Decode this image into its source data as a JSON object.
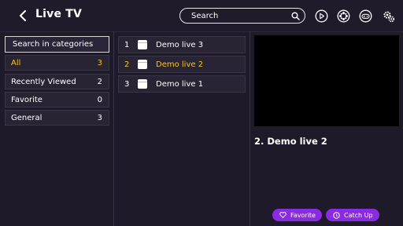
{
  "header": {
    "title": "Live TV",
    "search_placeholder": "Search",
    "icons": [
      "back-icon",
      "search-icon",
      "play-circle-icon",
      "film-reel-icon",
      "gamepad-icon",
      "settings-gear-icon"
    ]
  },
  "categories": {
    "search_label": "Search in categories",
    "items": [
      {
        "label": "All",
        "count": "3",
        "active": true
      },
      {
        "label": "Recently Viewed",
        "count": "2",
        "active": false
      },
      {
        "label": "Favorite",
        "count": "0",
        "active": false
      },
      {
        "label": "General",
        "count": "3",
        "active": false
      }
    ]
  },
  "channels": [
    {
      "num": "1",
      "name": "Demo live 3",
      "active": false
    },
    {
      "num": "2",
      "name": "Demo live 2",
      "active": true
    },
    {
      "num": "3",
      "name": "Demo live 1",
      "active": false
    }
  ],
  "player": {
    "now_playing": "2.  Demo live 2"
  },
  "actions": {
    "favorite_label": "Favorite",
    "catchup_label": "Catch Up"
  },
  "colors": {
    "accent": "#f2c230",
    "button": "#8a2be2",
    "background": "#1e1a2a"
  }
}
